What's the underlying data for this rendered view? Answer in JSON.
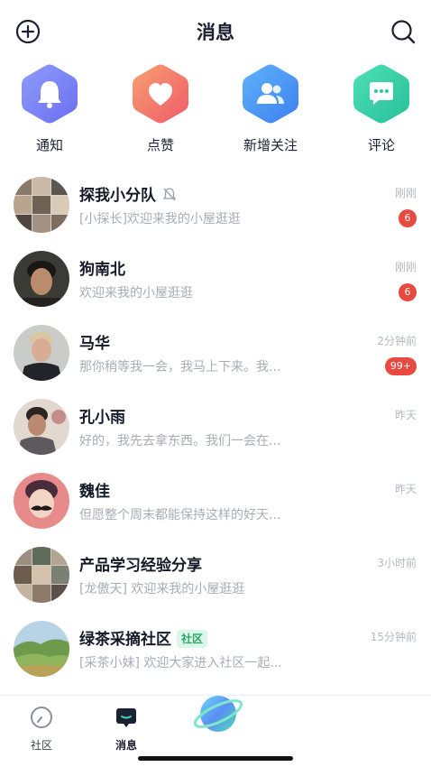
{
  "header": {
    "title": "消息",
    "add_icon": "plus-circle-icon",
    "search_icon": "search-icon"
  },
  "quick_actions": [
    {
      "label": "通知",
      "icon": "bell-icon",
      "color": "#7b86f5"
    },
    {
      "label": "点赞",
      "icon": "heart-icon",
      "color": "#f5716a"
    },
    {
      "label": "新增关注",
      "icon": "users-icon",
      "color": "#4f9af7"
    },
    {
      "label": "评论",
      "icon": "comment-icon",
      "color": "#39cfa6"
    }
  ],
  "conversations": [
    {
      "name": "探我小分队",
      "preview": "[小探长]欢迎来我的小屋逛逛",
      "time": "刚刚",
      "badge": "6",
      "muted": true
    },
    {
      "name": "狗南北",
      "preview": "欢迎来我的小屋逛逛",
      "time": "刚刚",
      "badge": "6"
    },
    {
      "name": "马华",
      "preview": "那你稍等我一会，我马上下来。我...",
      "time": "2分钟前",
      "badge": "99+"
    },
    {
      "name": "孔小雨",
      "preview": "好的，我先去拿东西。我们一会在...",
      "time": "昨天"
    },
    {
      "name": "魏佳",
      "preview": "但愿整个周末都能保持这样的好天...",
      "time": "昨天"
    },
    {
      "name": "产品学习经验分享",
      "preview": "[龙傲天] 欢迎来我的小屋逛逛",
      "time": "3小时前"
    },
    {
      "name": "绿茶采摘社区",
      "tag": "社区",
      "preview": "[采茶小妹] 欢迎大家进入社区一起...",
      "time": "15分钟前"
    }
  ],
  "tabbar": {
    "community_label": "社区",
    "messages_label": "消息",
    "active": "消息"
  },
  "colors": {
    "badge": "#e84a3f",
    "tag_text": "#2aa96c",
    "tag_bg": "#dcf6e8"
  }
}
